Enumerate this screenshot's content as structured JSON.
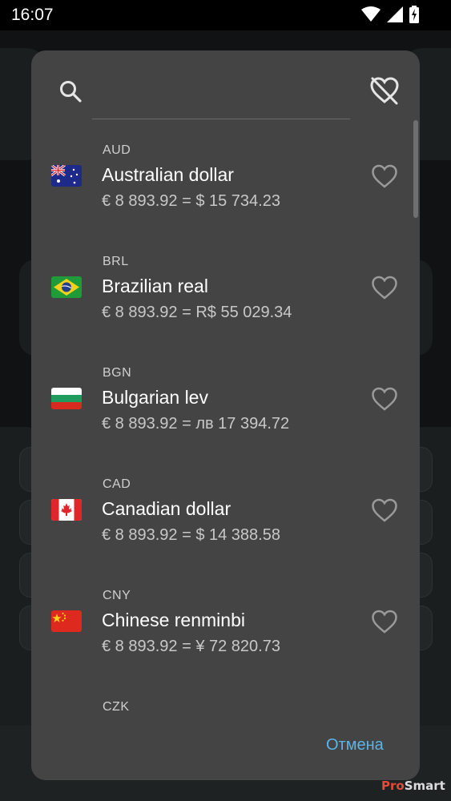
{
  "status_bar": {
    "time": "16:07",
    "icons": [
      "wifi-icon",
      "signal-icon",
      "battery-charging-icon"
    ]
  },
  "dialog": {
    "search": {
      "value": "",
      "placeholder": ""
    },
    "items": [
      {
        "code": "AUD",
        "name": "Australian dollar",
        "rate": "€ 8 893.92 = $ 15 734.23",
        "flag": "flag-au-icon"
      },
      {
        "code": "BRL",
        "name": "Brazilian real",
        "rate": "€ 8 893.92 = R$ 55 029.34",
        "flag": "flag-br-icon"
      },
      {
        "code": "BGN",
        "name": "Bulgarian lev",
        "rate": "€ 8 893.92 = лв 17 394.72",
        "flag": "flag-bg-icon"
      },
      {
        "code": "CAD",
        "name": "Canadian dollar",
        "rate": "€ 8 893.92 = $ 14 388.58",
        "flag": "flag-ca-icon"
      },
      {
        "code": "CNY",
        "name": "Chinese renminbi",
        "rate": "€ 8 893.92 = ¥ 72 820.73",
        "flag": "flag-cn-icon"
      },
      {
        "code": "CZK",
        "name": "",
        "rate": "",
        "flag": ""
      }
    ],
    "cancel_label": "Отмена"
  },
  "watermark": {
    "part1": "Pro",
    "part2": "Smart"
  },
  "colors": {
    "dialog_bg": "#444444",
    "accent": "#5cb3e6",
    "text_primary": "#ffffff",
    "text_secondary": "#c8c8c8"
  }
}
